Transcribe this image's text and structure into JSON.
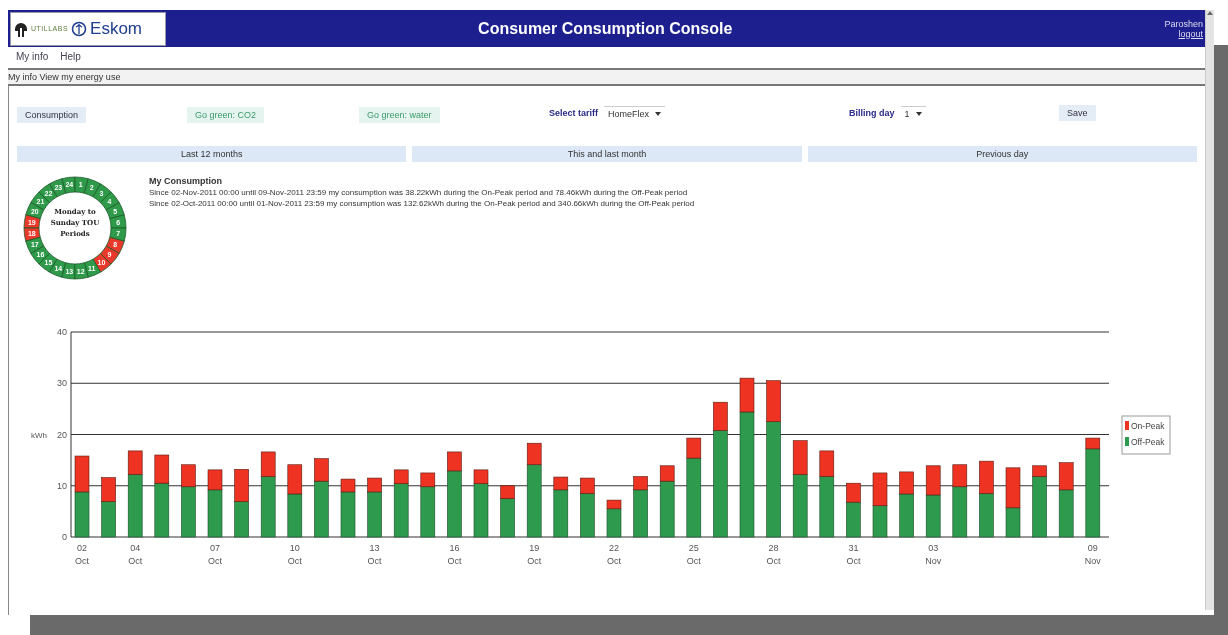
{
  "header": {
    "logo": {
      "brand": "UTILLABS",
      "partner": "Eskom"
    },
    "title": "Consumer Consumption Console",
    "user": "Paroshen",
    "logout": "logout"
  },
  "menu": [
    "My info",
    "Help"
  ],
  "breadcrumb": "My info View my energy use",
  "toolbar": {
    "buttons": [
      {
        "label": "Consumption",
        "kind": "plain"
      },
      {
        "label": "Go green: CO2",
        "kind": "green"
      },
      {
        "label": "Go green: water",
        "kind": "green"
      }
    ],
    "tariff": {
      "label": "Select tariff",
      "value": "HomeFlex"
    },
    "billing_day": {
      "label": "Billing day",
      "value": "1"
    },
    "save": "Save"
  },
  "period_tabs": [
    "Last 12 months",
    "This and last month",
    "Previous day"
  ],
  "tou_clock": {
    "caption": "Monday to Sunday TOU Periods",
    "hours_left": [
      {
        "label": "24",
        "peak": false
      },
      {
        "label": "23",
        "peak": false
      },
      {
        "label": "22",
        "peak": false
      },
      {
        "label": "21",
        "peak": false
      },
      {
        "label": "20",
        "peak": false
      },
      {
        "label": "19",
        "peak": true
      },
      {
        "label": "18",
        "peak": true
      },
      {
        "label": "17",
        "peak": false
      },
      {
        "label": "16",
        "peak": false
      },
      {
        "label": "15",
        "peak": false
      },
      {
        "label": "14",
        "peak": false
      },
      {
        "label": "13",
        "peak": false
      }
    ],
    "hours_right": [
      {
        "label": "1",
        "peak": false
      },
      {
        "label": "2",
        "peak": false
      },
      {
        "label": "3",
        "peak": false
      },
      {
        "label": "4",
        "peak": false
      },
      {
        "label": "5",
        "peak": false
      },
      {
        "label": "6",
        "peak": false
      },
      {
        "label": "7",
        "peak": false
      },
      {
        "label": "8",
        "peak": true
      },
      {
        "label": "9",
        "peak": true
      },
      {
        "label": "10",
        "peak": true
      },
      {
        "label": "11",
        "peak": false
      },
      {
        "label": "12",
        "peak": false
      }
    ]
  },
  "summary": {
    "title": "My Consumption",
    "lines": [
      "Since 02-Nov-2011 00:00 until 09-Nov-2011 23:59 my consumption was 38.22kWh during the On-Peak period and 78.46kWh during the Off-Peak period",
      "Since 02-Oct-2011 00:00 until 01-Nov-2011 23:59 my consumption was 132.62kWh during the On-Peak period and 340.66kWh during the Off-Peak period"
    ]
  },
  "chart_data": {
    "type": "bar",
    "stacked": true,
    "ylabel": "kWh",
    "ylim": [
      0,
      40
    ],
    "yticks": [
      {
        "value": 0,
        "label": "0"
      },
      {
        "value": 10,
        "label": "10"
      },
      {
        "value": 20,
        "label": "20"
      },
      {
        "value": 30,
        "label": "30"
      },
      {
        "value": 40,
        "label": "40"
      }
    ],
    "grid": true,
    "legend": true,
    "categories": [
      "02 Oct",
      null,
      "04 Oct",
      null,
      null,
      "07 Oct",
      null,
      null,
      "10 Oct",
      null,
      null,
      "13 Oct",
      null,
      null,
      "16 Oct",
      null,
      null,
      "19 Oct",
      null,
      null,
      "22 Oct",
      null,
      null,
      "25 Oct",
      null,
      null,
      "28 Oct",
      null,
      null,
      "31 Oct",
      null,
      null,
      "03 Nov",
      null,
      null,
      null,
      null,
      null,
      "09 Nov"
    ],
    "series": [
      {
        "name": "On-Peak",
        "color": "#ee3322",
        "values": [
          7.0,
          4.7,
          4.6,
          5.5,
          4.3,
          3.9,
          6.3,
          4.8,
          5.7,
          4.4,
          2.5,
          2.7,
          2.7,
          2.7,
          3.7,
          2.7,
          2.5,
          4.2,
          2.5,
          3.0,
          1.7,
          2.6,
          3.0,
          3.9,
          5.5,
          6.6,
          8.0,
          6.6,
          5.0,
          3.7,
          6.4,
          4.3,
          5.7,
          4.3,
          6.3,
          7.8,
          2.1,
          5.3,
          2.1
        ]
      },
      {
        "name": "Off-Peak",
        "color": "#2e9a4e",
        "values": [
          8.8,
          6.9,
          12.2,
          10.5,
          9.8,
          9.2,
          6.9,
          11.8,
          8.4,
          10.9,
          8.8,
          8.8,
          10.4,
          9.8,
          12.9,
          10.4,
          7.5,
          14.1,
          9.2,
          8.5,
          5.5,
          9.2,
          10.9,
          15.4,
          20.8,
          24.4,
          22.5,
          12.2,
          11.8,
          6.8,
          6.1,
          8.4,
          8.2,
          9.8,
          8.5,
          5.7,
          11.8,
          9.2,
          17.2
        ]
      }
    ]
  }
}
